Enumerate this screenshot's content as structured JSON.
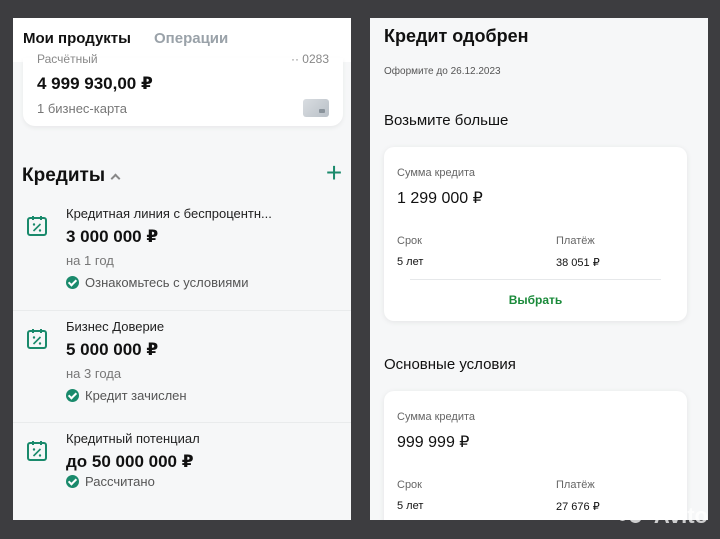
{
  "left": {
    "tabs": [
      "Мои продукты",
      "Операции"
    ],
    "account": {
      "type": "Расчётный",
      "number": "·· 0283",
      "balance": "4 999 930,00 ₽",
      "cards": "1 бизнес-карта"
    },
    "credits_title": "Кредиты",
    "credits": [
      {
        "name": "Кредитная линия с беспроцентн...",
        "amount": "3 000 000 ₽",
        "term": "на 1 год",
        "status": "Ознакомьтесь с условиями"
      },
      {
        "name": "Бизнес Доверие",
        "amount": "5 000 000 ₽",
        "term": "на 3 года",
        "status": "Кредит зачислен"
      },
      {
        "name": "Кредитный потенциал",
        "amount": "до 50 000 000 ₽",
        "term": "",
        "status": "Рассчитано"
      }
    ]
  },
  "right": {
    "title": "Кредит одобрен",
    "deadline": "Оформите до 26.12.2023",
    "section1": "Возьмите больше",
    "offer1": {
      "amount_label": "Сумма кредита",
      "amount": "1 299 000 ₽",
      "term_label": "Срок",
      "term": "5 лет",
      "payment_label": "Платёж",
      "payment": "38 051 ₽",
      "select": "Выбрать"
    },
    "section2": "Основные условия",
    "offer2": {
      "amount_label": "Сумма кредита",
      "amount": "999 999 ₽",
      "term_label": "Срок",
      "term": "5 лет",
      "payment_label": "Платёж",
      "payment": "27 676 ₽"
    }
  },
  "watermark": "Avito",
  "colors": {
    "accent": "#1a8a6c",
    "select_green": "#1a8a3a"
  }
}
